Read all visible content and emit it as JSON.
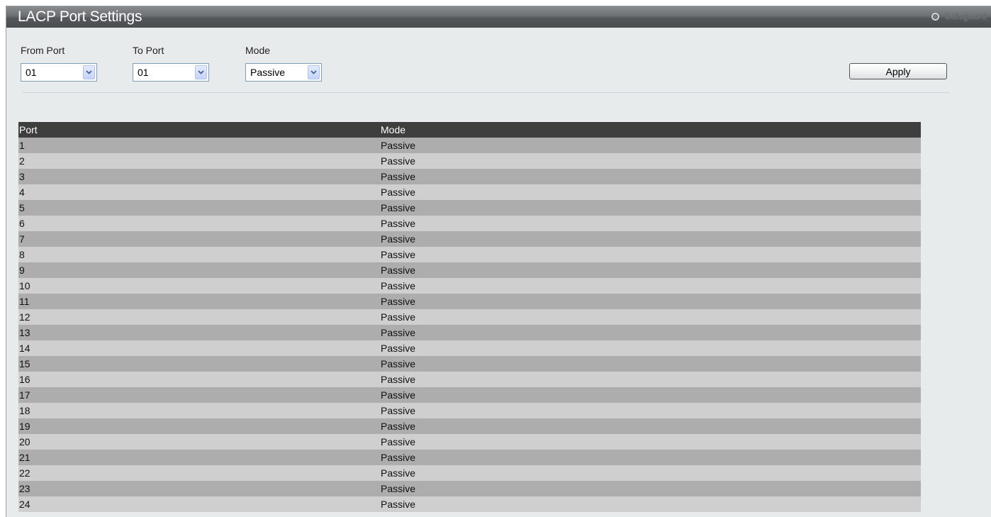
{
  "page": {
    "title": "LACP Port Settings",
    "safeguard_label": "Safeguard"
  },
  "form": {
    "from_port": {
      "label": "From Port",
      "value": "01"
    },
    "to_port": {
      "label": "To Port",
      "value": "01"
    },
    "mode": {
      "label": "Mode",
      "value": "Passive"
    },
    "apply_label": "Apply"
  },
  "table": {
    "headers": {
      "port": "Port",
      "mode": "Mode"
    },
    "rows": [
      {
        "port": "1",
        "mode": "Passive"
      },
      {
        "port": "2",
        "mode": "Passive"
      },
      {
        "port": "3",
        "mode": "Passive"
      },
      {
        "port": "4",
        "mode": "Passive"
      },
      {
        "port": "5",
        "mode": "Passive"
      },
      {
        "port": "6",
        "mode": "Passive"
      },
      {
        "port": "7",
        "mode": "Passive"
      },
      {
        "port": "8",
        "mode": "Passive"
      },
      {
        "port": "9",
        "mode": "Passive"
      },
      {
        "port": "10",
        "mode": "Passive"
      },
      {
        "port": "11",
        "mode": "Passive"
      },
      {
        "port": "12",
        "mode": "Passive"
      },
      {
        "port": "13",
        "mode": "Passive"
      },
      {
        "port": "14",
        "mode": "Passive"
      },
      {
        "port": "15",
        "mode": "Passive"
      },
      {
        "port": "16",
        "mode": "Passive"
      },
      {
        "port": "17",
        "mode": "Passive"
      },
      {
        "port": "18",
        "mode": "Passive"
      },
      {
        "port": "19",
        "mode": "Passive"
      },
      {
        "port": "20",
        "mode": "Passive"
      },
      {
        "port": "21",
        "mode": "Passive"
      },
      {
        "port": "22",
        "mode": "Passive"
      },
      {
        "port": "23",
        "mode": "Passive"
      },
      {
        "port": "24",
        "mode": "Passive"
      }
    ]
  },
  "colors": {
    "title_bar": "#5a5d5f",
    "background": "#e8ebec",
    "header_row": "#3e3e3e",
    "row_dark": "#adadad",
    "row_light": "#cfcfcf"
  },
  "icons": {
    "safeguard": "safeguard-indicator-icon",
    "dropdown": "chevron-down-icon"
  }
}
